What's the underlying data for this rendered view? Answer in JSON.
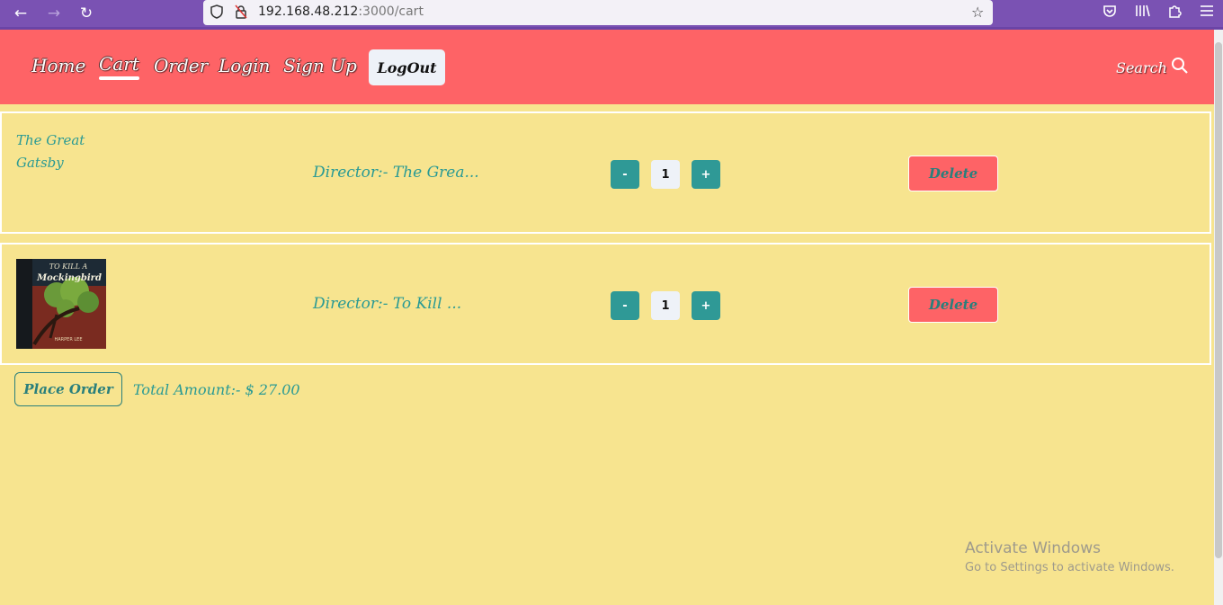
{
  "browser": {
    "url_host": "192.168.48.212",
    "url_path": ":3000/cart",
    "icons": [
      "back-arrow-icon",
      "forward-arrow-icon",
      "reload-icon",
      "shield-icon",
      "insecure-lock-icon",
      "star-icon",
      "pocket-icon",
      "library-icon",
      "extensions-icon",
      "menu-icon"
    ]
  },
  "nav": {
    "home": "Home",
    "cart": "Cart",
    "order": "Order",
    "login": "Login",
    "signup": "Sign Up",
    "logout": "LogOut",
    "search": "Search"
  },
  "cart": {
    "items": [
      {
        "title": "The Great Gatsby",
        "director": "Director:- The Grea...",
        "quantity": "1",
        "minus": "-",
        "plus": "+",
        "delete": "Delete"
      },
      {
        "cover_title": "TO KILL A",
        "cover_subtitle": "Mockingbird",
        "cover_author": "HARPER LEE",
        "director": "Director:- To Kill ...",
        "quantity": "1",
        "minus": "-",
        "plus": "+",
        "delete": "Delete"
      }
    ],
    "place_order": "Place Order",
    "total_label": "Total Amount:- $ 27.00"
  },
  "watermark": {
    "line1": "Activate Windows",
    "line2": "Go to Settings to activate Windows."
  },
  "colors": {
    "header": "#fe6366",
    "background": "#f7e48f",
    "teal": "#2f9996"
  }
}
